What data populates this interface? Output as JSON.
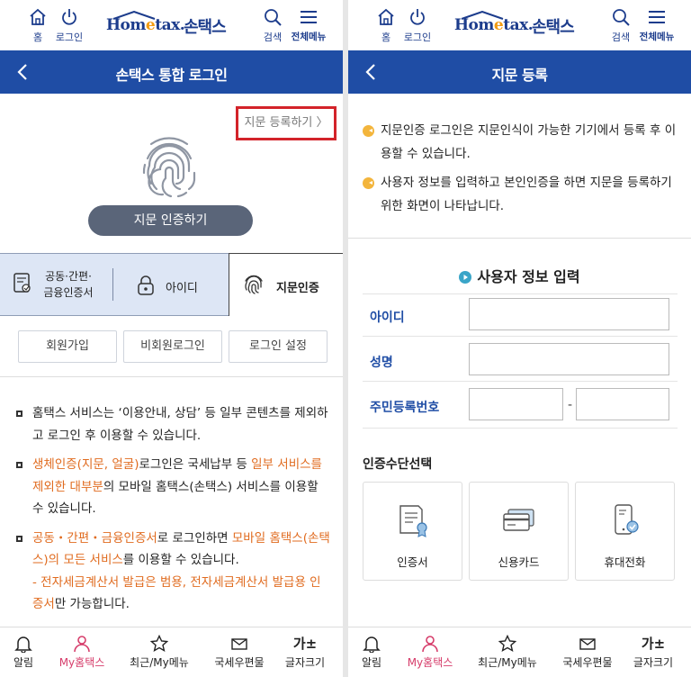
{
  "header": {
    "home_label": "홈",
    "logout_label": "로그인",
    "logo_home": "Hom",
    "logo_e": "e",
    "logo_tax": "tax.",
    "logo_sontax": "손택스",
    "search_label": "검색",
    "menu_label": "전체메뉴"
  },
  "left": {
    "title": "손택스 통합 로그인",
    "register_link": "지문 등록하기 〉",
    "auth_button": "지문 인증하기",
    "tabs": {
      "cert_line1": "공동·간편·",
      "cert_line2": "금융인증서",
      "id": "아이디",
      "fingerprint": "지문인증"
    },
    "buttons": {
      "join": "회원가입",
      "guest": "비회원로그인",
      "settings": "로그인 설정"
    },
    "notes": {
      "n1": "홈택스 서비스는 ‘이용안내, 상담’ 등 일부 콘텐츠를 제외하고 로그인 후 이용할 수 있습니다.",
      "n2_o1": "생체인증(지문, 얼굴)",
      "n2_t1": "로그인은 국세납부 등 ",
      "n2_o2": "일부 서비스를 제외한 대부분",
      "n2_t2": "의 모바일 홈택스(손택스) 서비스를 이용할 수 있습니다.",
      "n3_o1": "공동・간편・금융인증서",
      "n3_t1": "로 로그인하면 ",
      "n3_o2": "모바일 홈택스(손택스)의 모든 서비스",
      "n3_t2": "를 이용할 수 있습니다.",
      "n3_dash": "- ",
      "n3_o3": "전자세금계산서 발급은 범용, 전자세금계산서 발급용 인증서",
      "n3_t3": "만 가능합니다."
    }
  },
  "right": {
    "title": "지문 등록",
    "info1": "지문인증 로그인은 지문인식이 가능한 기기에서 등록 후 이용할 수 있습니다.",
    "info2": "사용자 정보를 입력하고 본인인증을 하면 지문을 등록하기 위한 화면이 나타납니다.",
    "section_title": "사용자 정보 입력",
    "form": {
      "id_label": "아이디",
      "name_label": "성명",
      "rrn_label": "주민등록번호",
      "id_value": "",
      "name_value": "",
      "rrn_front_value": "",
      "rrn_back_value": "",
      "dash": "-"
    },
    "method_title": "인증수단선택",
    "methods": {
      "cert": "인증서",
      "card": "신용카드",
      "phone": "휴대전화"
    }
  },
  "bottom_nav": {
    "alarm": "알림",
    "my": "My홈택스",
    "recent": "최근/My메뉴",
    "mail": "국세우편물",
    "font_icon": "가±",
    "font": "글자크기"
  },
  "colors": {
    "brand_blue": "#1f4da5",
    "highlight_red": "#d3232a",
    "accent_orange": "#e06b1f",
    "nav_active": "#d63c6a"
  },
  "icons": [
    "home-icon",
    "power-icon",
    "search-icon",
    "menu-icon",
    "back-icon",
    "fingerprint-icon",
    "certificate-icon",
    "lock-icon",
    "bell-icon",
    "person-icon",
    "star-icon",
    "mail-icon",
    "credit-card-icon",
    "mobile-phone-icon"
  ]
}
